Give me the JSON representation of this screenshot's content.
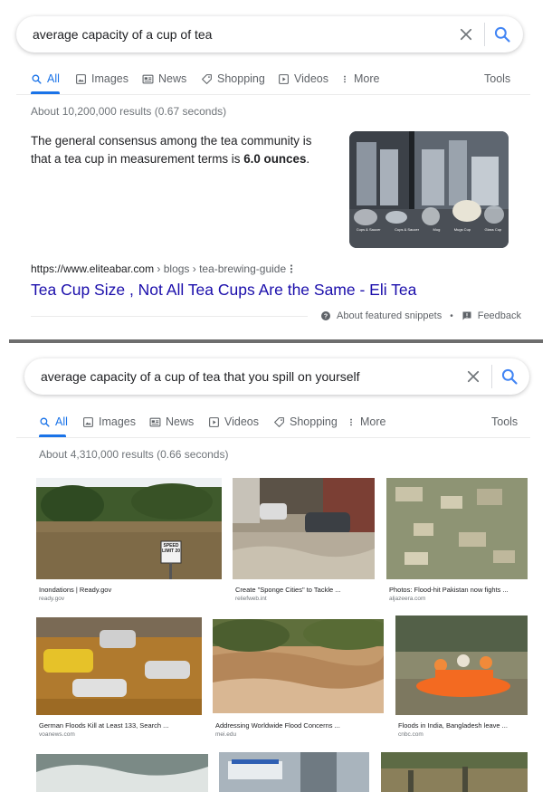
{
  "top": {
    "search": {
      "query": "average capacity of a cup of tea"
    },
    "tabs": [
      {
        "label": "All"
      },
      {
        "label": "Images"
      },
      {
        "label": "News"
      },
      {
        "label": "Shopping"
      },
      {
        "label": "Videos"
      },
      {
        "label": "More"
      }
    ],
    "tools_label": "Tools",
    "result_count": "About 10,200,000 results (0.67 seconds)",
    "snippet": {
      "text_before": "The general consensus among the tea community is that a tea cup in measurement terms is ",
      "bold": "6.0 ounces",
      "text_after": "."
    },
    "image_captions": [
      "Cups & Saucer",
      "Cups & Saucer",
      "Mug",
      "Mugs Cup",
      "Glass Cup"
    ],
    "result": {
      "url_domain": "https://www.eliteabar.com",
      "url_path": " › blogs › tea-brewing-guide",
      "title": "Tea Cup Size , Not All Tea Cups Are the Same - Eli Tea"
    },
    "about_snippets": "About featured snippets",
    "feedback": "Feedback"
  },
  "bottom": {
    "search": {
      "query": "average capacity of a cup of tea that you spill on yourself"
    },
    "tabs": [
      {
        "label": "All"
      },
      {
        "label": "Images"
      },
      {
        "label": "News"
      },
      {
        "label": "Videos"
      },
      {
        "label": "Shopping"
      },
      {
        "label": "More"
      }
    ],
    "tools_label": "Tools",
    "result_count": "About 4,310,000 results (0.66 seconds)",
    "images": [
      {
        "caption": "Inondations | Ready.gov",
        "source": "ready.gov"
      },
      {
        "caption": "Create \"Sponge Cities\" to Tackle ...",
        "source": "reliefweb.int"
      },
      {
        "caption": "Photos: Flood-hit Pakistan now fights ...",
        "source": "aljazeera.com"
      },
      {
        "caption": "German Floods Kill at Least 133, Search ...",
        "source": "voanews.com"
      },
      {
        "caption": "Addressing Worldwide Flood Concerns ...",
        "source": "mei.edu"
      },
      {
        "caption": "Floods in India, Bangladesh leave ...",
        "source": "cnbc.com"
      }
    ],
    "sign_text": "SPEED LIMIT 20"
  }
}
